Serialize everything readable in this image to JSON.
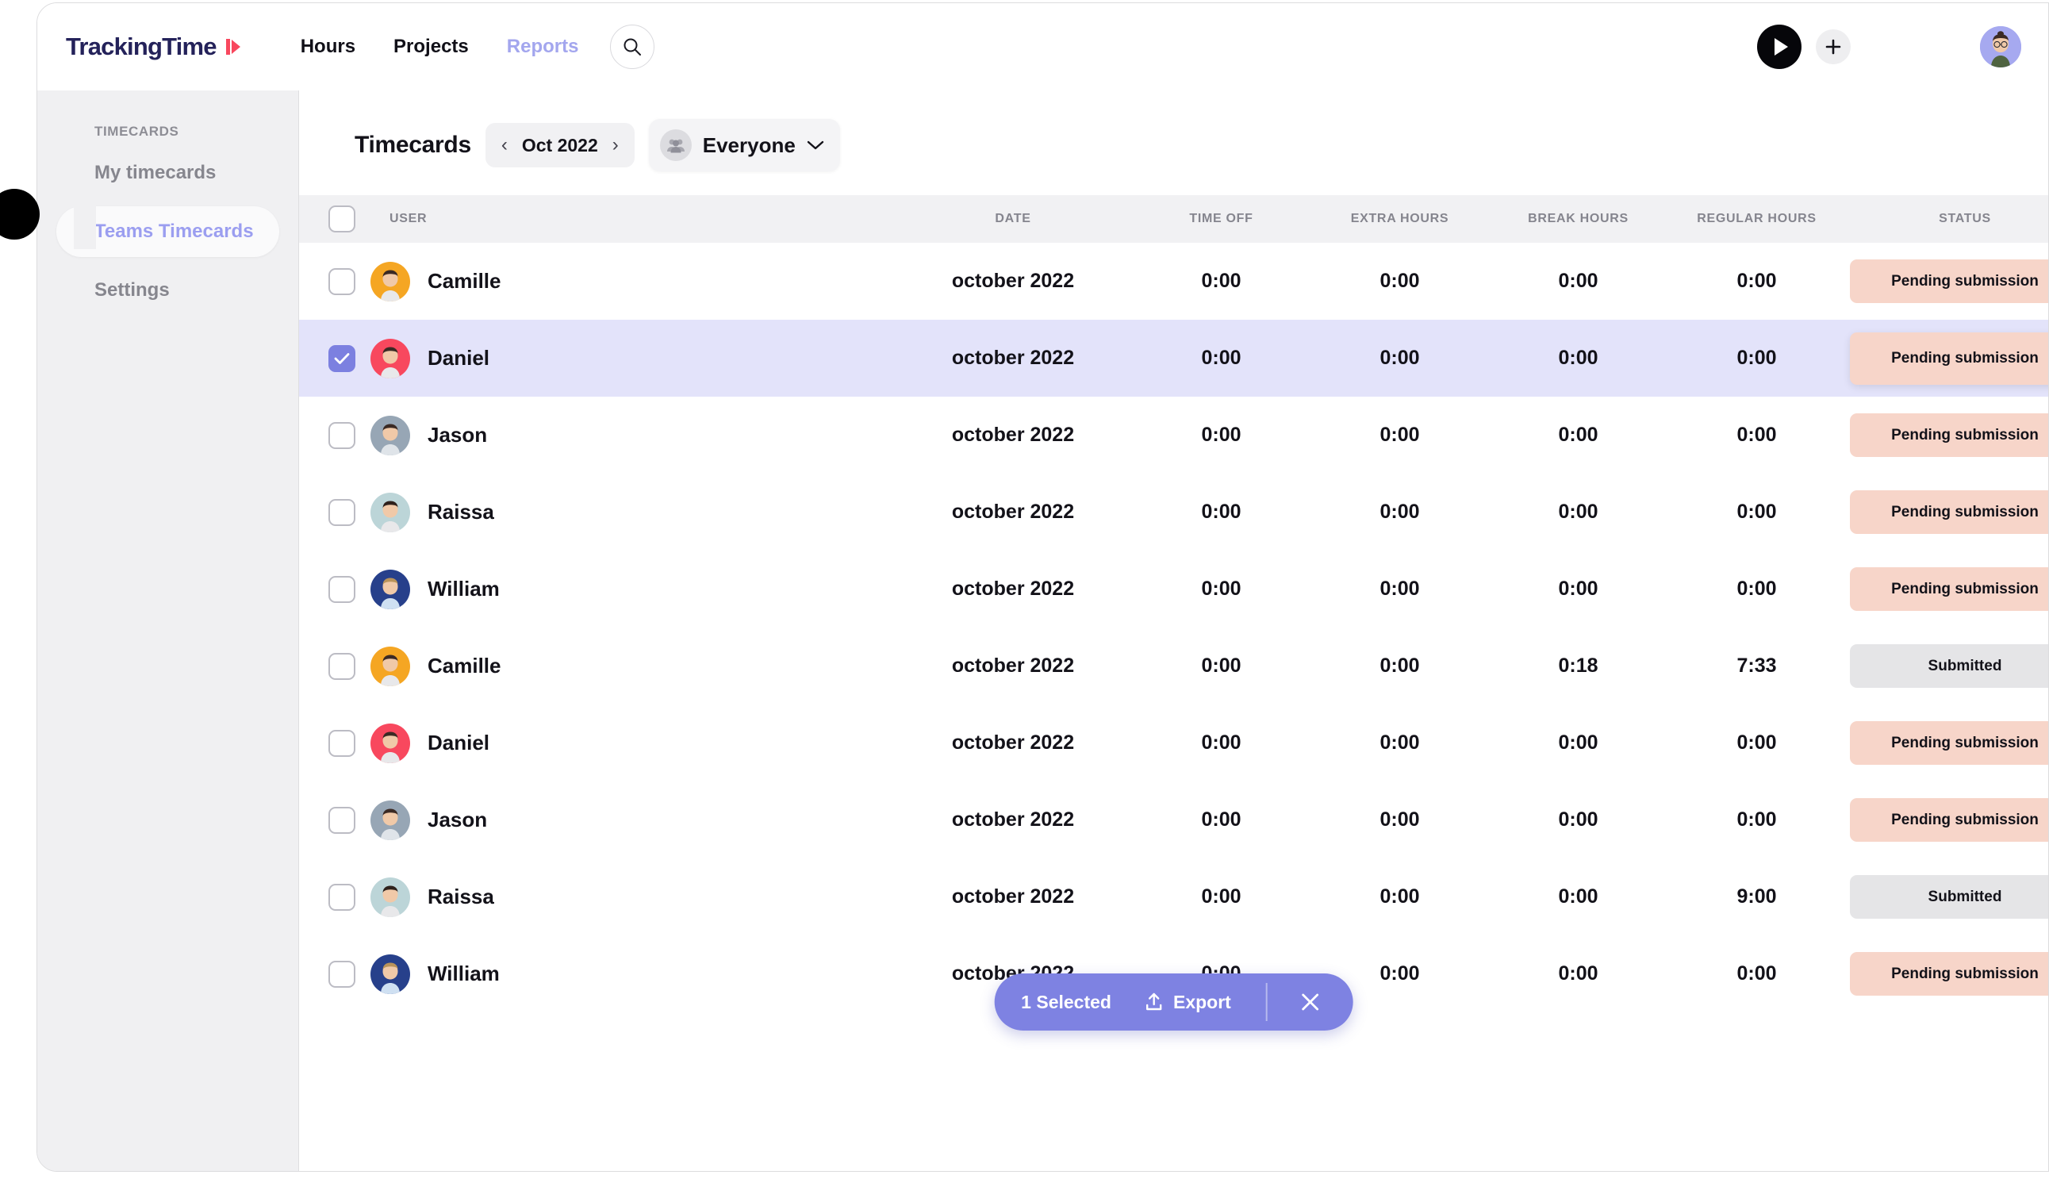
{
  "app": {
    "logo_text": "TrackingTime",
    "logo_icon": "play-mark-icon"
  },
  "nav": {
    "items": [
      {
        "label": "Hours",
        "active": true
      },
      {
        "label": "Projects",
        "active": true
      },
      {
        "label": "Reports",
        "active": false
      }
    ],
    "search_icon": "search-icon",
    "play_icon": "play-icon",
    "add_icon": "plus-icon",
    "avatar_icon": "user-avatar"
  },
  "sidebar": {
    "section_label": "TIMECARDS",
    "items": [
      {
        "label": "My timecards",
        "active": false
      },
      {
        "label": "Teams Timecards",
        "active": true
      },
      {
        "label": "Settings",
        "active": false
      }
    ],
    "collapse_icon": "collapse-handle-icon"
  },
  "toolbar": {
    "title": "Timecards",
    "date_prev_icon": "chevron-left-icon",
    "date_label": "Oct 2022",
    "date_next_icon": "chevron-right-icon",
    "filter_label": "Everyone",
    "filter_icon": "group-people-icon",
    "filter_chevron_icon": "chevron-down-icon"
  },
  "table": {
    "columns": [
      "USER",
      "DATE",
      "TIME OFF",
      "EXTRA HOURS",
      "BREAK HOURS",
      "REGULAR HOURS",
      "STATUS"
    ],
    "rows": [
      {
        "user": "Camille",
        "avatar_color": "#f5a623",
        "date": "october 2022",
        "time_off": "0:00",
        "extra_hours": "0:00",
        "break_hours": "0:00",
        "regular_hours": "0:00",
        "status": "Pending submission",
        "status_type": "pending",
        "selected": false
      },
      {
        "user": "Daniel",
        "avatar_color": "#f8485e",
        "date": "october 2022",
        "time_off": "0:00",
        "extra_hours": "0:00",
        "break_hours": "0:00",
        "regular_hours": "0:00",
        "status": "Pending submission",
        "status_type": "pending",
        "selected": true
      },
      {
        "user": "Jason",
        "avatar_color": "#97a6b5",
        "date": "october 2022",
        "time_off": "0:00",
        "extra_hours": "0:00",
        "break_hours": "0:00",
        "regular_hours": "0:00",
        "status": "Pending submission",
        "status_type": "pending",
        "selected": false
      },
      {
        "user": "Raissa",
        "avatar_color": "#bcd5d8",
        "date": "october 2022",
        "time_off": "0:00",
        "extra_hours": "0:00",
        "break_hours": "0:00",
        "regular_hours": "0:00",
        "status": "Pending submission",
        "status_type": "pending",
        "selected": false
      },
      {
        "user": "William",
        "avatar_color": "#27408b",
        "date": "october 2022",
        "time_off": "0:00",
        "extra_hours": "0:00",
        "break_hours": "0:00",
        "regular_hours": "0:00",
        "status": "Pending submission",
        "status_type": "pending",
        "selected": false
      },
      {
        "user": "Camille",
        "avatar_color": "#f5a623",
        "date": "october 2022",
        "time_off": "0:00",
        "extra_hours": "0:00",
        "break_hours": "0:18",
        "regular_hours": "7:33",
        "status": "Submitted",
        "status_type": "submitted",
        "selected": false
      },
      {
        "user": "Daniel",
        "avatar_color": "#f8485e",
        "date": "october 2022",
        "time_off": "0:00",
        "extra_hours": "0:00",
        "break_hours": "0:00",
        "regular_hours": "0:00",
        "status": "Pending submission",
        "status_type": "pending",
        "selected": false
      },
      {
        "user": "Jason",
        "avatar_color": "#97a6b5",
        "date": "october 2022",
        "time_off": "0:00",
        "extra_hours": "0:00",
        "break_hours": "0:00",
        "regular_hours": "0:00",
        "status": "Pending submission",
        "status_type": "pending",
        "selected": false
      },
      {
        "user": "Raissa",
        "avatar_color": "#bcd5d8",
        "date": "october 2022",
        "time_off": "0:00",
        "extra_hours": "0:00",
        "break_hours": "0:00",
        "regular_hours": "9:00",
        "status": "Submitted",
        "status_type": "submitted",
        "selected": false
      },
      {
        "user": "William",
        "avatar_color": "#27408b",
        "date": "october 2022",
        "time_off": "0:00",
        "extra_hours": "0:00",
        "break_hours": "0:00",
        "regular_hours": "0:00",
        "status": "Pending submission",
        "status_type": "pending",
        "selected": false
      }
    ]
  },
  "selection_bar": {
    "count_label": "1 Selected",
    "export_label": "Export",
    "export_icon": "upload-icon",
    "close_icon": "close-icon"
  },
  "colors": {
    "accent_purple": "#7c80e0",
    "selected_row": "#e3e3fa",
    "badge_pending": "#f7d5c9",
    "badge_submitted": "#e5e5e7",
    "sidebar_bg": "#f0f0f2",
    "logo_navy": "#24225a",
    "logo_red": "#f8485e"
  }
}
